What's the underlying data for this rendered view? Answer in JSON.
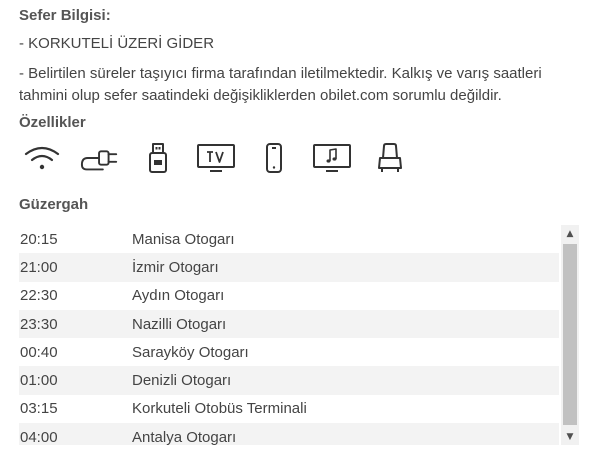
{
  "trip_info": {
    "title": "Sefer Bilgisi:",
    "line1": "- KORKUTELİ ÜZERİ GİDER",
    "line2": "- Belirtilen süreler taşıyıcı firma tarafından iletilmektedir. Kalkış ve varış saatleri tahmini olup sefer saatindeki değişikliklerden obilet.com sorumlu değildir."
  },
  "features": {
    "title": "Özellikler",
    "icons": [
      "wifi-icon",
      "power-outlet-icon",
      "usb-icon",
      "tv-icon",
      "phone-icon",
      "personal-screen-icon",
      "seat-icon"
    ]
  },
  "route": {
    "title": "Güzergah",
    "stops": [
      {
        "time": "20:15",
        "name": "Manisa Otogarı"
      },
      {
        "time": "21:00",
        "name": "İzmir Otogarı"
      },
      {
        "time": "22:30",
        "name": "Aydın Otogarı"
      },
      {
        "time": "23:30",
        "name": "Nazilli Otogarı"
      },
      {
        "time": "00:40",
        "name": "Sarayköy Otogarı"
      },
      {
        "time": "01:00",
        "name": "Denizli Otogarı"
      },
      {
        "time": "03:15",
        "name": "Korkuteli Otobüs Terminali"
      },
      {
        "time": "04:00",
        "name": "Antalya Otogarı"
      }
    ]
  },
  "scrollbar": {
    "up_arrow": "▲",
    "down_arrow": "▼"
  },
  "colors": {
    "icon_stroke": "#333333",
    "row_alt_bg": "#f3f3f3",
    "scroll_thumb": "#c1c1c1"
  }
}
